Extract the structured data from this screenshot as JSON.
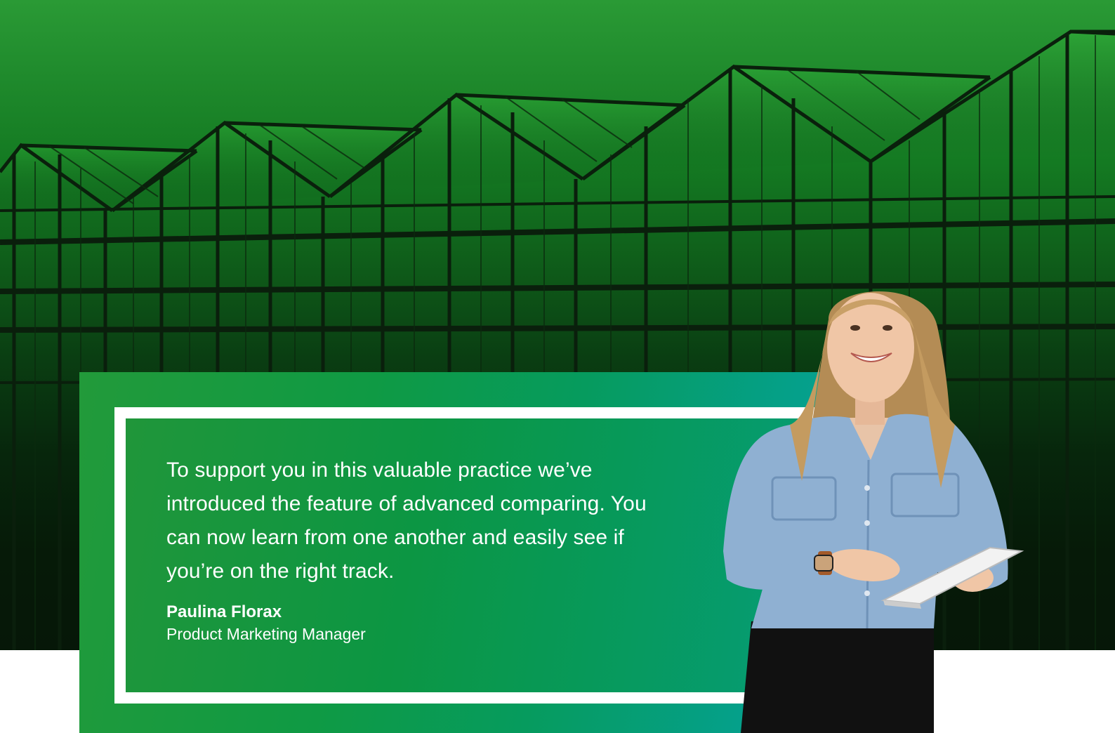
{
  "quote": {
    "text": "To support you in this valuable practice we’ve introduced the feature of advanced comparing. You can now learn from one another and easily see if you’re on the right track.",
    "author_name": "Paulina Florax",
    "author_title": "Product Marketing Manager"
  },
  "colors": {
    "hero_top": "#2a9a35",
    "hero_bottom": "#061708",
    "card_left": "#229a3a",
    "card_right": "#0aa39c",
    "frame": "#ffffff"
  }
}
